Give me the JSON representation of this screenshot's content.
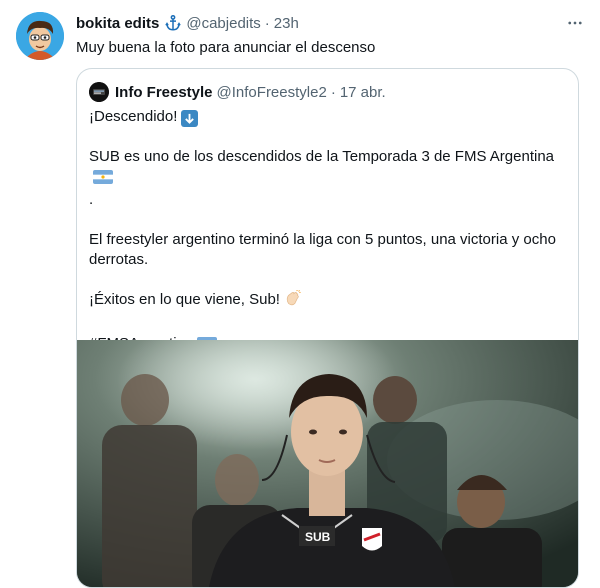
{
  "tweet": {
    "display_name": "bokita edits",
    "handle": "@cabjedits",
    "separator": "·",
    "time": "23h",
    "text": "Muy buena la foto para anunciar el descenso"
  },
  "quoted": {
    "display_name": "Info Freestyle",
    "handle": "@InfoFreestyle2",
    "separator": "·",
    "time": "17 abr.",
    "line1": "¡Descendido!",
    "line2": "SUB es uno de los descendidos de la Temporada 3 de FMS Argentina",
    "line2b": ".",
    "line3": "El freestyler argentino terminó la liga con 5 puntos, una victoria y ocho derrotas.",
    "line4": "¡Éxitos en lo que viene, Sub!",
    "hashtag": "#FMSArgentina",
    "photo_shirt_text": "SUB"
  },
  "icons": {
    "anchor": "anchor-icon",
    "more": "more-icon",
    "flag": "argentina-flag-icon",
    "arrow": "down-arrow-icon",
    "clap": "clapping-hands-icon"
  },
  "colors": {
    "text": "#0f1419",
    "secondary": "#536471",
    "border": "#cfd9de",
    "accent": "#1d9bf0"
  }
}
